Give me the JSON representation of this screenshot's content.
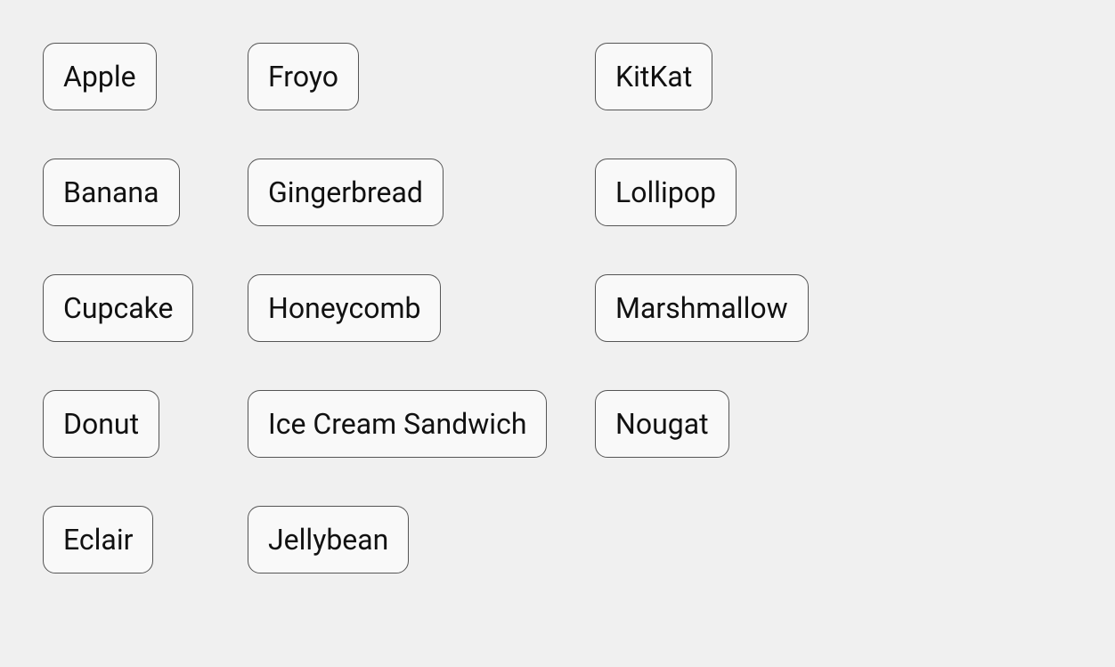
{
  "chips": {
    "col1": [
      {
        "id": "apple",
        "label": "Apple"
      },
      {
        "id": "banana",
        "label": "Banana"
      },
      {
        "id": "cupcake",
        "label": "Cupcake"
      },
      {
        "id": "donut",
        "label": "Donut"
      },
      {
        "id": "eclair",
        "label": "Eclair"
      }
    ],
    "col2": [
      {
        "id": "froyo",
        "label": "Froyo"
      },
      {
        "id": "gingerbread",
        "label": "Gingerbread"
      },
      {
        "id": "honeycomb",
        "label": "Honeycomb"
      },
      {
        "id": "ice-cream-sandwich",
        "label": "Ice Cream Sandwich"
      },
      {
        "id": "jellybean",
        "label": "Jellybean"
      }
    ],
    "col3": [
      {
        "id": "kitkat",
        "label": "KitKat"
      },
      {
        "id": "lollipop",
        "label": "Lollipop"
      },
      {
        "id": "marshmallow",
        "label": "Marshmallow"
      },
      {
        "id": "nougat",
        "label": "Nougat"
      }
    ]
  }
}
